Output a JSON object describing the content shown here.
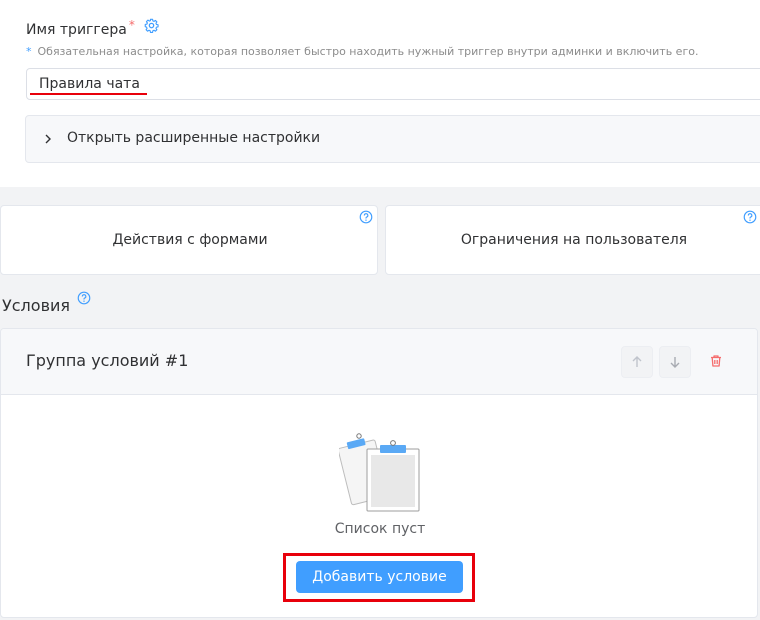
{
  "trigger": {
    "label": "Имя триггера",
    "required_mark": "*",
    "hint_mark": "*",
    "hint": "Обязательная настройка, которая позволяет быстро находить нужный триггер внутри админки и включить его.",
    "value": "Правила чата",
    "advanced_label": "Открыть расширенные настройки"
  },
  "tiles": {
    "forms_label": "Действия с формами",
    "users_label": "Ограничения на пользователя"
  },
  "conditions": {
    "title": "Условия",
    "group_title": "Группа условий #1",
    "empty_text": "Список пуст",
    "add_button": "Добавить условие"
  },
  "colors": {
    "primary": "#409eff",
    "danger": "#f56c6c",
    "annotation": "#e8000b"
  },
  "icons": {
    "settings": "gear-icon",
    "help": "question-circle-icon",
    "expand": "chevron-right-icon",
    "move_up": "arrow-up-icon",
    "move_down": "arrow-down-icon",
    "delete": "trash-icon",
    "empty": "clipboard-illustration"
  }
}
